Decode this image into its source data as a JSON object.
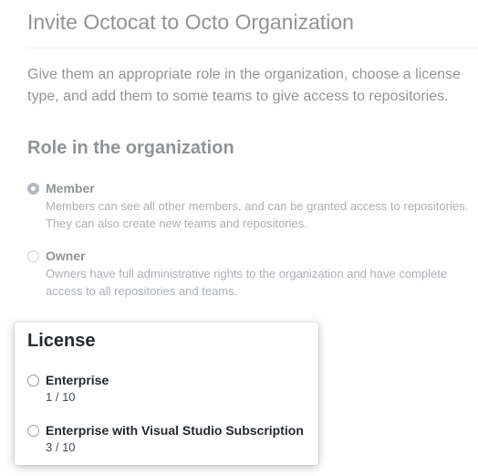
{
  "header": {
    "title": "Invite Octocat to Octo Organization",
    "intro": "Give them an appropriate role in the organization, choose a license type, and add them to some teams to give access to repositories."
  },
  "role_section": {
    "heading": "Role in the organization",
    "options": [
      {
        "label": "Member",
        "description": "Members can see all other members, and can be granted access to repositories. They can also create new teams and repositories.",
        "selected": true
      },
      {
        "label": "Owner",
        "description": "Owners have full administrative rights to the organization and have complete access to all repositories and teams.",
        "selected": false
      }
    ]
  },
  "license_section": {
    "heading": "License",
    "options": [
      {
        "label": "Enterprise",
        "count": "1 / 10",
        "selected": false
      },
      {
        "label": "Enterprise with Visual Studio Subscription",
        "count": "3 / 10",
        "selected": false
      }
    ]
  },
  "colors": {
    "text": "#24292e",
    "muted": "#586069",
    "divider": "#e1e4e8",
    "card_background": "#ffffff"
  }
}
